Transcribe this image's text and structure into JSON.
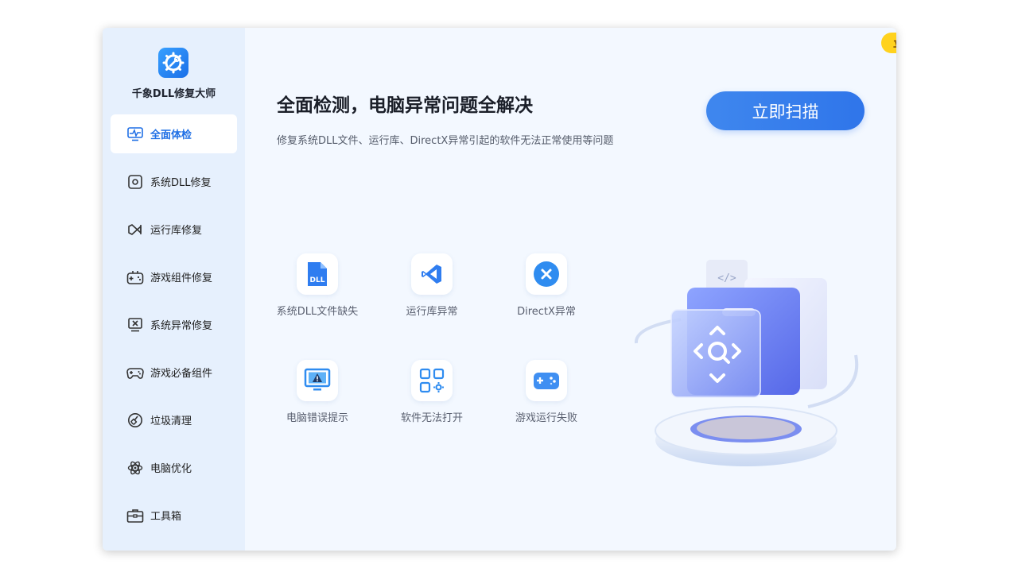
{
  "app": {
    "title": "千象DLL修复大师",
    "logo_icon": "gear-wrench-icon",
    "accent": "#1f6fe5"
  },
  "sidebar": {
    "items": [
      {
        "label": "全面体检",
        "icon": "monitor-pulse-icon",
        "active": true
      },
      {
        "label": "系统DLL修复",
        "icon": "dll-gear-icon",
        "active": false
      },
      {
        "label": "运行库修复",
        "icon": "visual-studio-icon",
        "active": false
      },
      {
        "label": "游戏组件修复",
        "icon": "gamepad-icon",
        "active": false
      },
      {
        "label": "系统异常修复",
        "icon": "monitor-x-icon",
        "active": false
      },
      {
        "label": "游戏必备组件",
        "icon": "controller-icon",
        "active": false
      },
      {
        "label": "垃圾清理",
        "icon": "broom-icon",
        "active": false
      },
      {
        "label": "电脑优化",
        "icon": "atom-icon",
        "active": false
      },
      {
        "label": "工具箱",
        "icon": "toolbox-icon",
        "active": false
      }
    ]
  },
  "titlebar": {
    "login_label": "立即登录",
    "login_color": "#ffd21e",
    "menu_icon": "menu-list-icon",
    "minimize_icon": "minimize-icon",
    "close_icon": "close-icon"
  },
  "main": {
    "headline": "全面检测，电脑异常问题全解决",
    "subline": "修复系统DLL文件、运行库、DirectX异常引起的软件无法正常使用等问题",
    "scan_label": "立即扫描",
    "issues": [
      {
        "label": "系统DLL文件缺失",
        "icon": "dll-file-icon"
      },
      {
        "label": "运行库异常",
        "icon": "visual-studio-icon"
      },
      {
        "label": "DirectX异常",
        "icon": "directx-x-icon"
      },
      {
        "label": "电脑错误提示",
        "icon": "monitor-warning-icon"
      },
      {
        "label": "软件无法打开",
        "icon": "app-grid-gear-icon"
      },
      {
        "label": "游戏运行失败",
        "icon": "gamepad-icon"
      }
    ]
  }
}
